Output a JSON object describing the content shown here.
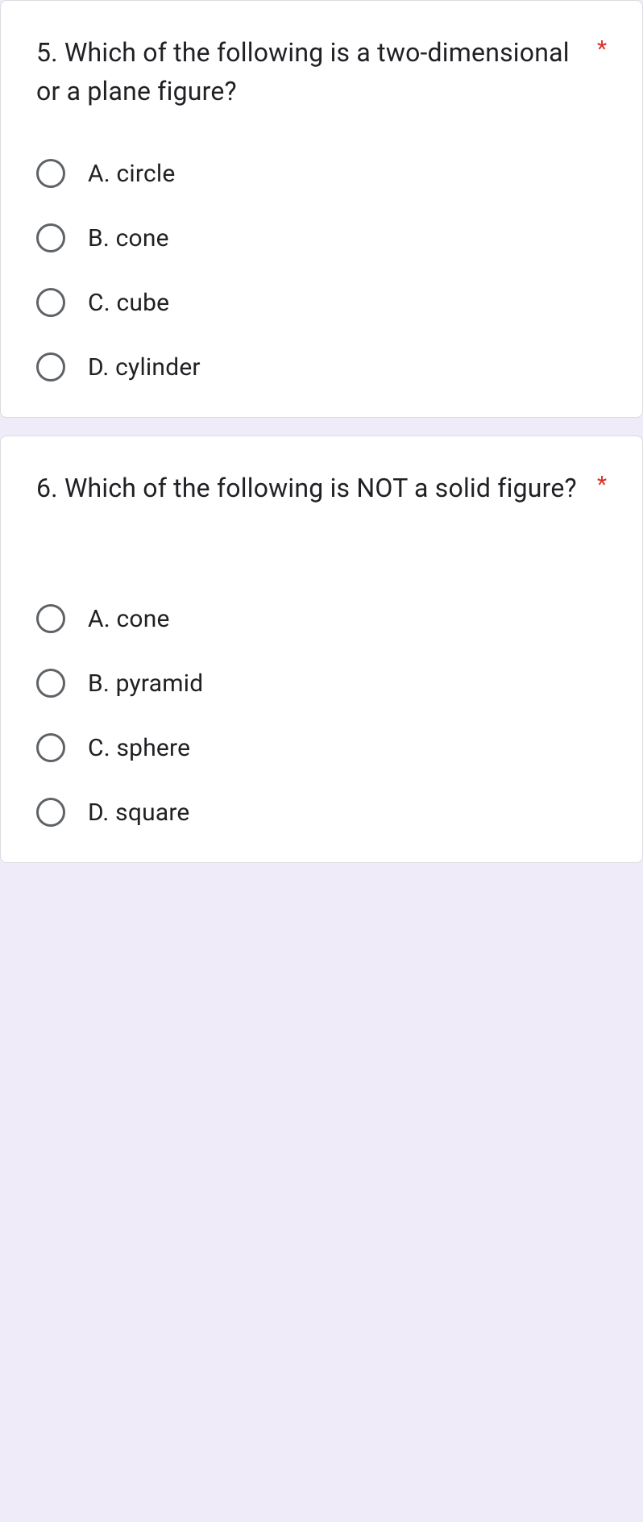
{
  "questions": [
    {
      "text": "5. Which of the following is a two-dimensional or a plane figure?",
      "required_mark": "*",
      "options": [
        {
          "label": "A. circle"
        },
        {
          "label": "B. cone"
        },
        {
          "label": "C. cube"
        },
        {
          "label": "D. cylinder"
        }
      ]
    },
    {
      "text": "6. Which of the following is NOT a solid figure?",
      "required_mark": "*",
      "options": [
        {
          "label": "A.  cone"
        },
        {
          "label": "B. pyramid"
        },
        {
          "label": "C. sphere"
        },
        {
          "label": "D. square"
        }
      ]
    }
  ]
}
